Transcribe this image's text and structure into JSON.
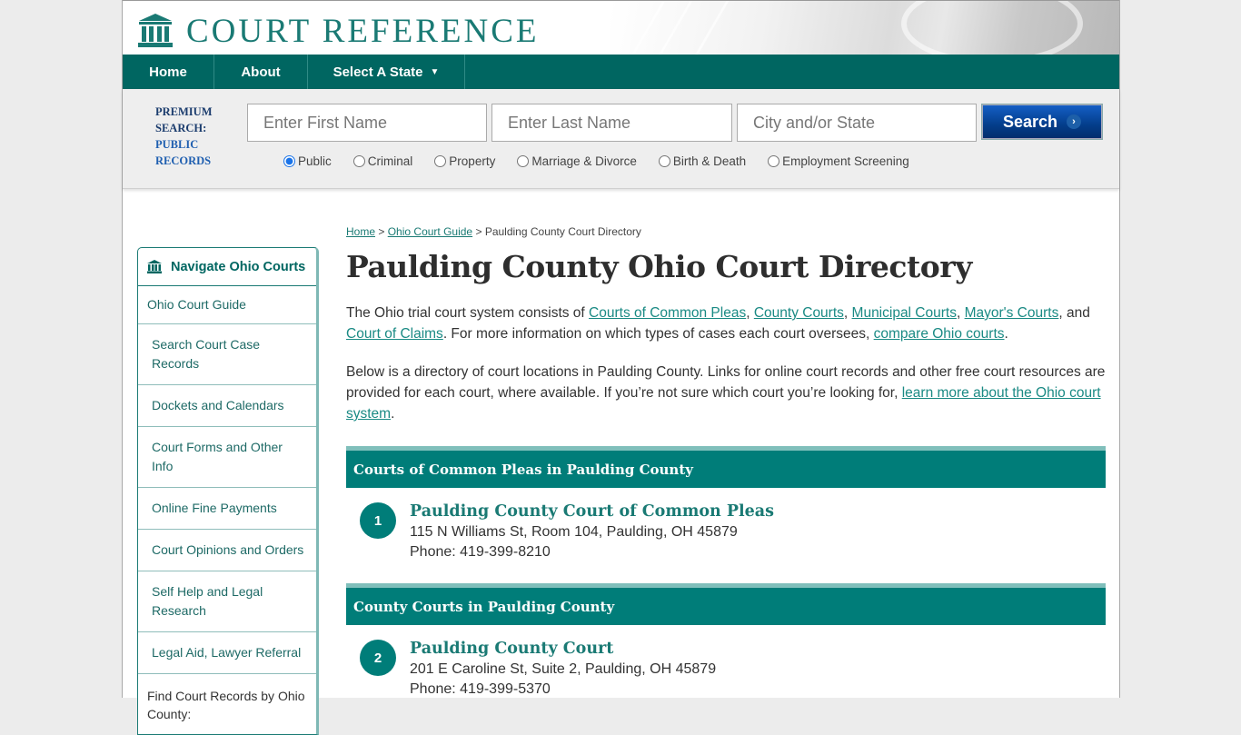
{
  "header": {
    "logo_text": "COURT REFERENCE",
    "logo_icon": "courthouse-icon"
  },
  "nav": {
    "home": "Home",
    "about": "About",
    "select_state": "Select A State",
    "caret": "▼"
  },
  "search": {
    "premium_line1": "PREMIUM",
    "premium_line2": "SEARCH:",
    "premium_line3": "PUBLIC",
    "premium_line4": "RECORDS",
    "first_name_placeholder": "Enter First Name",
    "last_name_placeholder": "Enter Last Name",
    "city_placeholder": "City and/or State",
    "button_label": "Search",
    "button_icon": "›",
    "radios": [
      {
        "label": "Public",
        "checked": true
      },
      {
        "label": "Criminal",
        "checked": false
      },
      {
        "label": "Property",
        "checked": false
      },
      {
        "label": "Marriage & Divorce",
        "checked": false
      },
      {
        "label": "Birth & Death",
        "checked": false
      },
      {
        "label": "Employment Screening",
        "checked": false
      }
    ]
  },
  "sidebar": {
    "title": "Navigate Ohio Courts",
    "items": [
      "Ohio Court Guide",
      "Search Court Case Records",
      "Dockets and Calendars",
      "Court Forms and Other Info",
      "Online Fine Payments",
      "Court Opinions and Orders",
      "Self Help and Legal Research",
      "Legal Aid, Lawyer Referral",
      "Find Court Records by Ohio County:"
    ]
  },
  "breadcrumb": {
    "home": "Home",
    "sep": ">",
    "guide": "Ohio Court Guide",
    "current": "Paulding County Court Directory"
  },
  "page": {
    "title": "Paulding County Ohio Court Directory",
    "intro1": {
      "t1": "The Ohio trial court system consists of ",
      "l1": "Courts of Common Pleas",
      "l2": "County Courts",
      "l3": "Municipal Courts",
      "l4": "Mayor's Courts",
      "t2": "and ",
      "l5": "Court of Claims",
      "t3": ". For more information on which types of cases each court oversees, ",
      "l6": "compare Ohio courts",
      "t4": "."
    },
    "intro2": {
      "t1": "Below is a directory of court locations in Paulding County. Links for online court records and other free court resources are provided for each court, where available. If you’re not sure which court you’re looking for, ",
      "l1": "learn more about the Ohio court system",
      "t2": "."
    }
  },
  "sections": [
    {
      "heading": "Courts of Common Pleas in Paulding County",
      "courts": [
        {
          "number": "1",
          "name": "Paulding County Court of Common Pleas",
          "address": "115 N Williams St, Room 104, Paulding, OH 45879",
          "phone": "Phone: 419-399-8210"
        }
      ]
    },
    {
      "heading": "County Courts in Paulding County",
      "courts": [
        {
          "number": "2",
          "name": "Paulding County Court",
          "address": "201 E Caroline St, Suite 2, Paulding, OH 45879",
          "phone": "Phone: 419-399-5370"
        }
      ]
    }
  ],
  "colors": {
    "brand_teal": "#006661",
    "section_teal": "#007d79",
    "link_teal": "#1a8a84",
    "search_blue": "#033d8a"
  }
}
